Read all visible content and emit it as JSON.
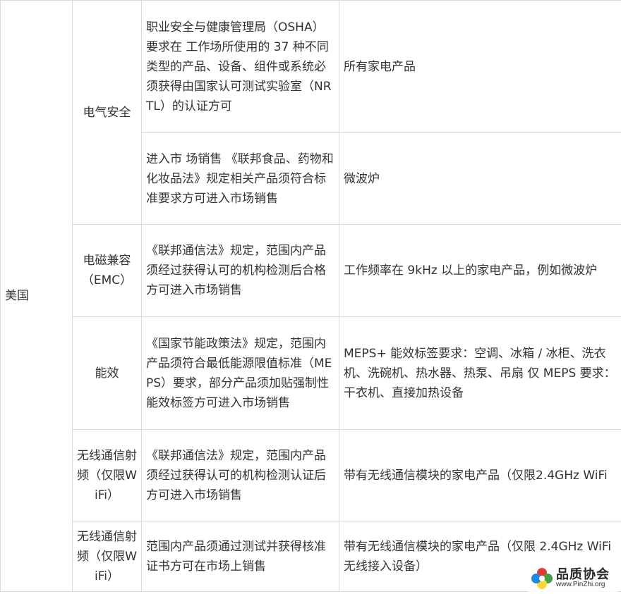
{
  "country": "美国",
  "rows": [
    {
      "category": "电气安全",
      "requirement": "职业安全与健康管理局（OSHA）要求在 工作场所使用的 37 种不同类型的产品、设备、组件或系统必须获得由国家认可测试实验室（NRTL）的认证方可",
      "scope": "所有家电产品"
    },
    {
      "category": "电气安全",
      "requirement": "进入市 场销售 《联邦食品、药物和化妆品法》规定相关产品须符合标准要求方可进入市场销售",
      "scope": "微波炉"
    },
    {
      "category": "电磁兼容（EMC）",
      "requirement": "《联邦通信法》规定，范围内产品须经过获得认可的机构检测后合格方可进入市场销售",
      "scope": "工作频率在 9kHz 以上的家电产品，例如微波炉"
    },
    {
      "category": "能效",
      "requirement": "《国家节能政策法》规定，范围内产品须符合最低能源限值标准（MEPS）要求，部分产品须加贴强制性能效标签方可进入市场销售",
      "scope": "MEPS+ 能效标签要求：空调、冰箱 / 冰柜、洗衣机、洗碗机、热水器、热泵、吊扇 仅 MEPS 要求：干衣机、直接加热设备"
    },
    {
      "category": "无线通信射频（仅限WiFi）",
      "requirement": "《联邦通信法》规定，范围内产品须经过获得认可的机构检测认证后方可进入市场销售",
      "scope": "带有无线通信模块的家电产品（仅限2.4GHz WiFi"
    },
    {
      "category": "无线通信射频（仅限WiFi）",
      "requirement": "范围内产品须通过测试并获得核准证书方可在市场上销售",
      "scope": "带有无线通信模块的家电产品（仅限 2.4GHz WiFi 无线接入设备）"
    }
  ],
  "watermark": {
    "title": "品质协会",
    "url": "www.PinZhi.org"
  }
}
